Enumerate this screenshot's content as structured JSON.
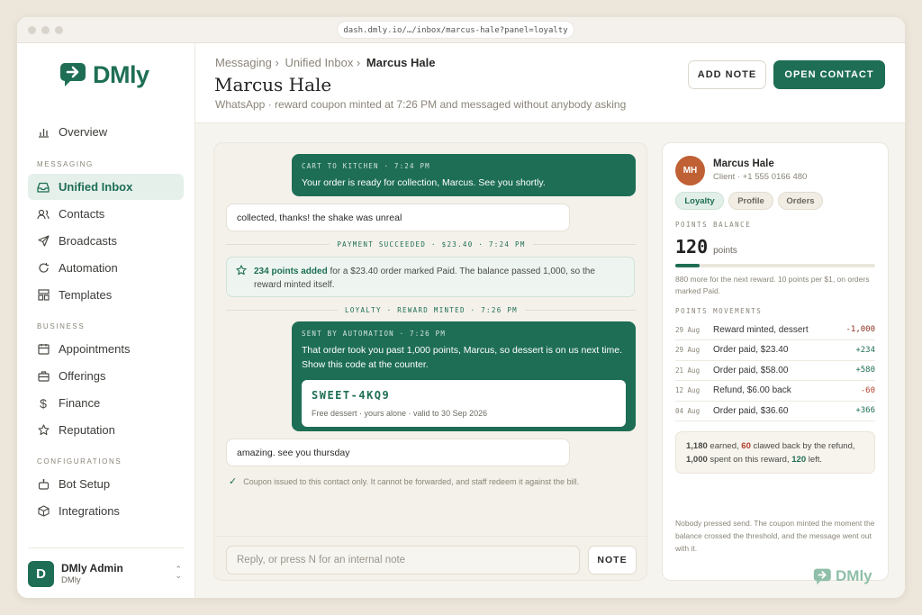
{
  "browser": {
    "url": "dash.dmly.io/…/inbox/marcus-hale?panel=loyalty"
  },
  "brand": {
    "name": "DMly",
    "accent": "#1e6e55"
  },
  "sidebar": {
    "overview": "Overview",
    "sections": {
      "messaging": "MESSAGING",
      "business": "BUSINESS",
      "configurations": "CONFIGURATIONS"
    },
    "messaging": [
      {
        "label": "Unified Inbox",
        "icon": "inbox-icon"
      },
      {
        "label": "Contacts",
        "icon": "contacts-icon"
      },
      {
        "label": "Broadcasts",
        "icon": "send-icon"
      },
      {
        "label": "Automation",
        "icon": "refresh-icon"
      },
      {
        "label": "Templates",
        "icon": "templates-icon"
      }
    ],
    "business": [
      {
        "label": "Appointments",
        "icon": "calendar-icon"
      },
      {
        "label": "Offerings",
        "icon": "briefcase-icon"
      },
      {
        "label": "Finance",
        "icon": "dollar-icon"
      },
      {
        "label": "Reputation",
        "icon": "star-icon"
      }
    ],
    "configurations": [
      {
        "label": "Bot Setup",
        "icon": "bot-icon"
      },
      {
        "label": "Integrations",
        "icon": "cube-icon"
      }
    ],
    "user": {
      "initial": "D",
      "name": "DMly Admin",
      "org": "DMly"
    }
  },
  "header": {
    "breadcrumb": [
      "Messaging ›",
      "Unified Inbox ›",
      "Marcus Hale"
    ],
    "title": "Marcus Hale",
    "subtitle": "WhatsApp · reward coupon minted at 7:26 PM and messaged without anybody asking",
    "add_note": "ADD NOTE",
    "open_contact": "OPEN CONTACT"
  },
  "chat": {
    "msg1": {
      "meta": "CART TO KITCHEN · 7:24 PM",
      "text": "Your order is ready for collection, Marcus. See you shortly."
    },
    "reply1": "collected, thanks! the shake was unreal",
    "divider1": "PAYMENT SUCCEEDED · $23.40 · 7:24 PM",
    "points": {
      "strong": "234 points added",
      "text": " for a $23.40 order marked Paid. The balance passed 1,000, so the reward minted itself."
    },
    "divider2": "LOYALTY · REWARD MINTED · 7:26 PM",
    "msg2": {
      "meta": "SENT BY AUTOMATION · 7:26 PM",
      "text": "That order took you past 1,000 points, Marcus, so dessert is on us next time. Show this code at the counter.",
      "code": "SWEET-4KQ9",
      "code_note": "Free dessert · yours alone · valid to 30 Sep 2026"
    },
    "reply2": "amazing. see you thursday",
    "issued": "Coupon issued to this contact only. It cannot be forwarded, and staff redeem it against the bill.",
    "composer_placeholder": "Reply, or press N for an internal note",
    "note_button": "NOTE"
  },
  "panel": {
    "initials": "MH",
    "name": "Marcus Hale",
    "meta": "Client · +1 555 0166 480",
    "tabs": [
      "Loyalty",
      "Profile",
      "Orders"
    ],
    "balance_label": "POINTS BALANCE",
    "balance": "120",
    "balance_unit": "points",
    "progress": 0.12,
    "progress_note": "880 more for the next reward. 10 points per $1, on orders marked Paid.",
    "movements_label": "POINTS MOVEMENTS",
    "movements": [
      {
        "date": "29 Aug",
        "label": "Reward minted, dessert",
        "amount": "-1,000",
        "color": "#8a2f1e"
      },
      {
        "date": "29 Aug",
        "label": "Order paid, $23.40",
        "amount": "+234",
        "color": "#1e6e55"
      },
      {
        "date": "21 Aug",
        "label": "Order paid, $58.00",
        "amount": "+580",
        "color": "#1e6e55"
      },
      {
        "date": "12 Aug",
        "label": "Refund, $6.00 back",
        "amount": "-60",
        "color": "#b3402a"
      },
      {
        "date": "04 Aug",
        "label": "Order paid, $36.60",
        "amount": "+366",
        "color": "#1e6e55"
      }
    ],
    "summary": {
      "earned": "1,180",
      "earned_txt": " earned, ",
      "clawed": "60",
      "clawed_txt": " clawed back by the refund,",
      "spent": "1,000",
      "spent_txt": " spent on this reward, ",
      "left": "120",
      "left_txt": " left."
    },
    "footnote": "Nobody pressed send. The coupon minted the moment the balance crossed the threshold, and the message went out with it."
  }
}
